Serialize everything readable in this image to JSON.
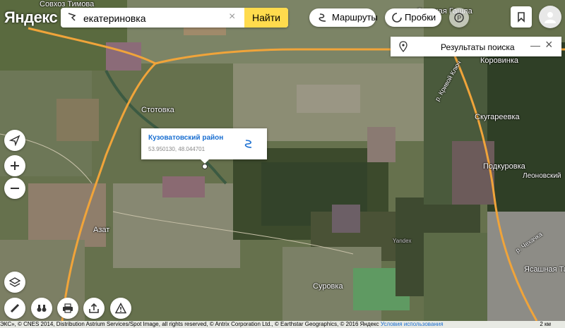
{
  "logo": {
    "text": "Яндекс"
  },
  "search": {
    "query": "екатериновка",
    "submit_label": "Найти"
  },
  "header": {
    "routes_label": "Маршруты",
    "traffic_label": "Пробки"
  },
  "results_panel": {
    "title": "Результаты поиска"
  },
  "popup": {
    "title": "Кузоватовский район",
    "coords": "53.950130, 48.044701"
  },
  "places": {
    "top_left": "Совхоз Тимова",
    "top_right": "Сорская Гашла",
    "korovinka": "Коровинка",
    "stotovka": "Стотовка",
    "krivoy_klyuch": "р. Кривой Ключ",
    "skugareevka": "Скугареевка",
    "podkurovka": "Подкуровка",
    "leonovsky": "Леоновский",
    "azat": "Азат",
    "surovka": "Суровка",
    "chekhachka": "р. Чехачка",
    "yasashnaya": "Ясашная Та",
    "yandex_mark": "Yandex"
  },
  "footer": {
    "copyright": "ЭКС», © CNES 2014, Distribution Astrium Services/Spot Image, all rights reserved, © Antrix Corporation Ltd., © Earthstar Geographics, © 2016 Яндекс",
    "terms": "Условия использования",
    "scale": "2 км"
  },
  "colors": {
    "accent": "#ffdb4d",
    "link": "#1a6fd1",
    "road": "#f0a43a"
  }
}
